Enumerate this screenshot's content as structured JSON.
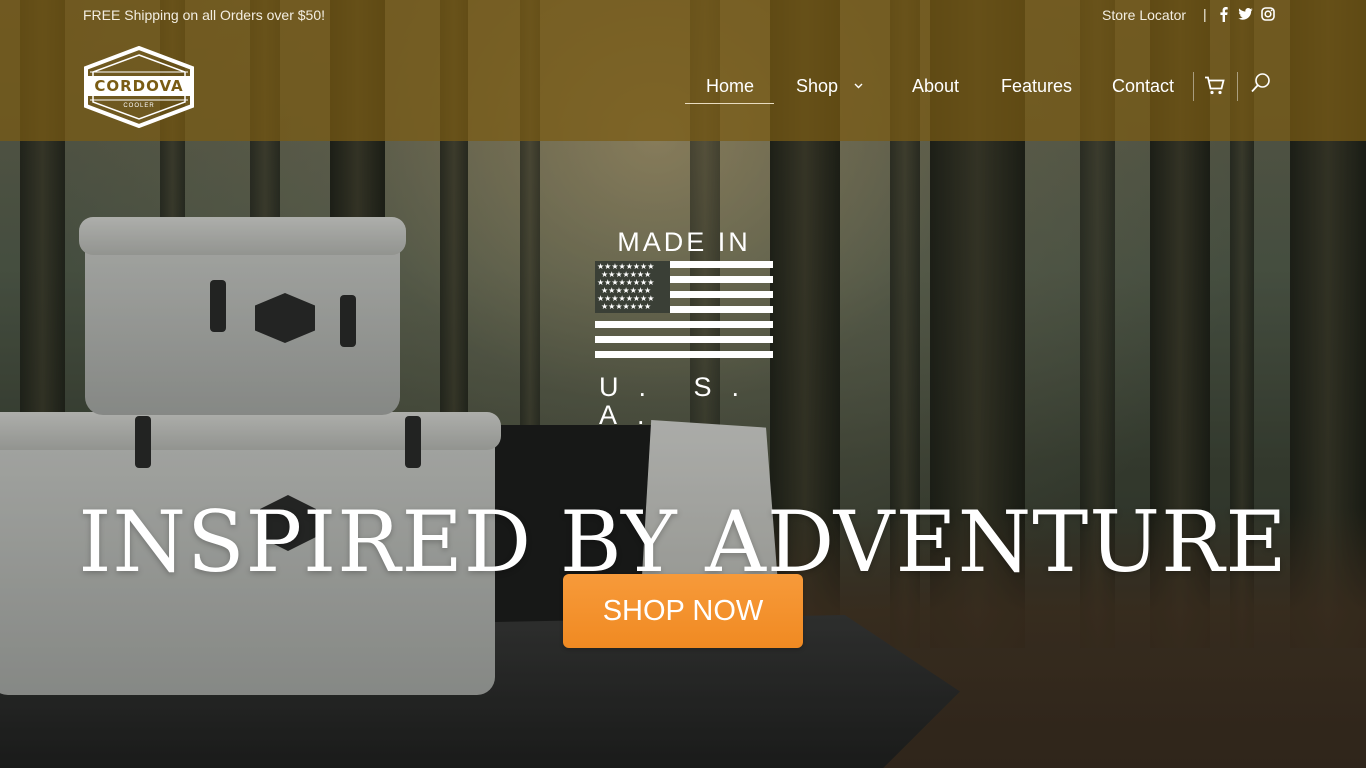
{
  "topbar": {
    "shipping_text": "FREE Shipping on all Orders over $50!",
    "store_locator": "Store Locator",
    "separator": "|",
    "social": [
      "facebook-icon",
      "twitter-icon",
      "instagram-icon"
    ]
  },
  "logo": {
    "brand": "CORDOVA",
    "sub": "COOLER"
  },
  "nav": {
    "items": [
      {
        "label": "Home",
        "active": true
      },
      {
        "label": "Shop",
        "has_dropdown": true
      },
      {
        "label": "About"
      },
      {
        "label": "Features"
      },
      {
        "label": "Contact"
      }
    ],
    "icons": [
      "cart-icon",
      "search-icon"
    ]
  },
  "hero": {
    "badge_top": "MADE IN",
    "badge_bottom": "U. S. A.",
    "headline": "INSPIRED BY ADVENTURE",
    "cta_label": "SHOP NOW"
  },
  "colors": {
    "header_bg": "#7a5c14",
    "cta_bg": "#f08a22",
    "text": "#ffffff"
  }
}
